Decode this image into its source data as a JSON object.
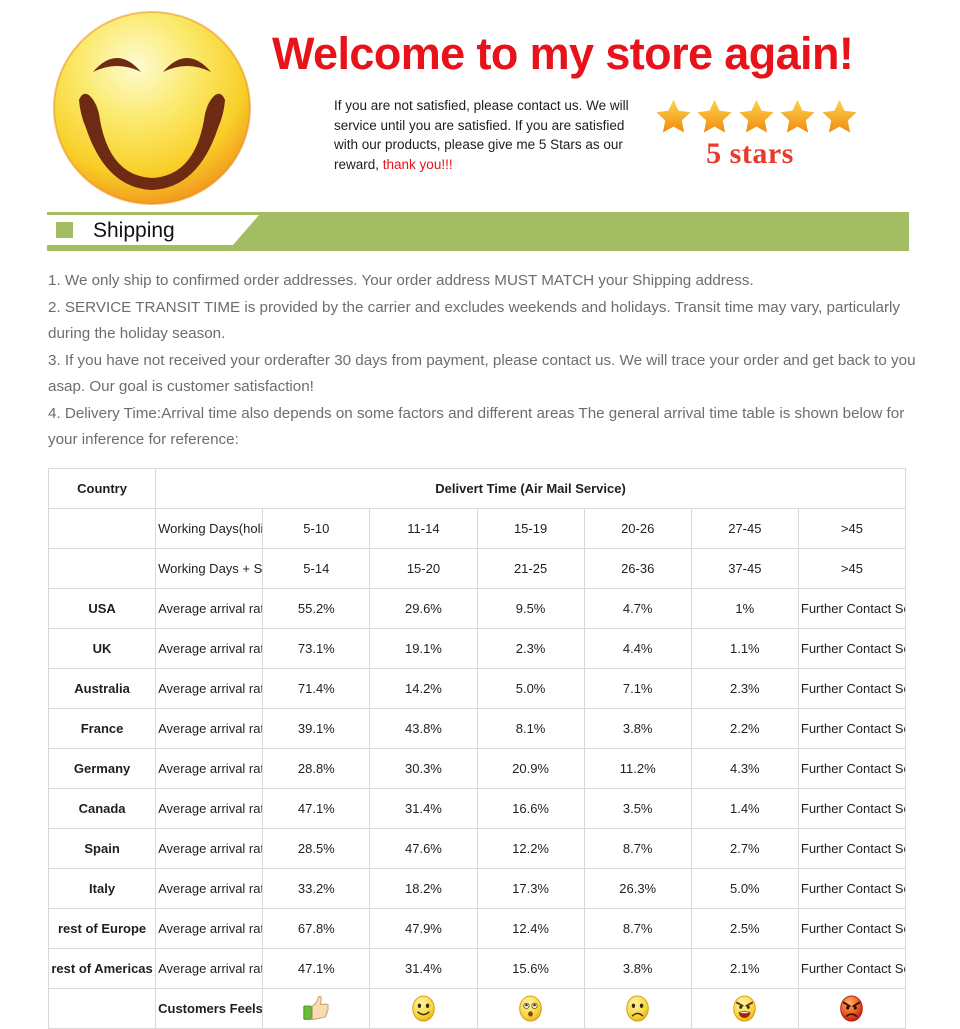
{
  "header": {
    "title": "Welcome to my store again!",
    "blurb_main": "If you are not satisfied, please contact us. We will service until you are satisfied. If you are satisfied with our products, please give me 5 Stars as our reward,",
    "blurb_thanks": "thank you!!!",
    "stars_label": "5 stars",
    "stars_count": 5,
    "title_color": "#e8121a",
    "stars_color": "#f5a017",
    "smiley_icon": "smiley-face-icon"
  },
  "section": {
    "title": "Shipping",
    "bar_color": "#a3bd63"
  },
  "notes": [
    "1. We only ship to confirmed order addresses. Your order address MUST MATCH your Shipping address.",
    "2. SERVICE TRANSIT TIME is provided by the carrier and excludes weekends and holidays. Transit time may vary, particularly during the holiday season.",
    "3. If you have not received your orderafter 30 days from payment, please contact us. We will trace your order and get back to you asap. Our goal is customer satisfaction!",
    "4. Delivery Time:Arrival time also depends on some factors and different areas The general arrival time table is shown below for your inference for reference:"
  ],
  "table": {
    "header": {
      "country": "Country",
      "delivery": "Delivert Time (Air Mail Service)"
    },
    "timing_rows": [
      {
        "label": "Working Days(holiday not incl)",
        "values": [
          "5-10",
          "11-14",
          "15-19",
          "20-26",
          "27-45"
        ],
        "last": ">45"
      },
      {
        "label": "Working Days + Sat + Sun",
        "values": [
          "5-14",
          "15-20",
          "21-25",
          "26-36",
          "37-45"
        ],
        "last": ">45"
      }
    ],
    "metric_label": "Average arrival rate",
    "last_col_label": "Further Contact Seller",
    "country_rows": [
      {
        "country": "USA",
        "values": [
          "55.2%",
          "29.6%",
          "9.5%",
          "4.7%",
          "1%"
        ]
      },
      {
        "country": "UK",
        "values": [
          "73.1%",
          "19.1%",
          "2.3%",
          "4.4%",
          "1.1%"
        ]
      },
      {
        "country": "Australia",
        "values": [
          "71.4%",
          "14.2%",
          "5.0%",
          "7.1%",
          "2.3%"
        ]
      },
      {
        "country": "France",
        "values": [
          "39.1%",
          "43.8%",
          "8.1%",
          "3.8%",
          "2.2%"
        ]
      },
      {
        "country": "Germany",
        "values": [
          "28.8%",
          "30.3%",
          "20.9%",
          "11.2%",
          "4.3%"
        ]
      },
      {
        "country": "Canada",
        "values": [
          "47.1%",
          "31.4%",
          "16.6%",
          "3.5%",
          "1.4%"
        ]
      },
      {
        "country": "Spain",
        "values": [
          "28.5%",
          "47.6%",
          "12.2%",
          "8.7%",
          "2.7%"
        ]
      },
      {
        "country": "Italy",
        "values": [
          "33.2%",
          "18.2%",
          "17.3%",
          "26.3%",
          "5.0%"
        ]
      },
      {
        "country": "rest of Europe",
        "values": [
          "67.8%",
          "47.9%",
          "12.4%",
          "8.7%",
          "2.5%"
        ]
      },
      {
        "country": "rest of Americas",
        "values": [
          "47.1%",
          "31.4%",
          "15.6%",
          "3.8%",
          "2.1%"
        ]
      }
    ],
    "feels_row": {
      "label": "Customers Feels",
      "icons": [
        "thumbs-up-icon",
        "smiling-face-icon",
        "surprised-face-icon",
        "sad-face-icon",
        "angry-face-icon",
        "red-angry-face-icon"
      ]
    }
  }
}
